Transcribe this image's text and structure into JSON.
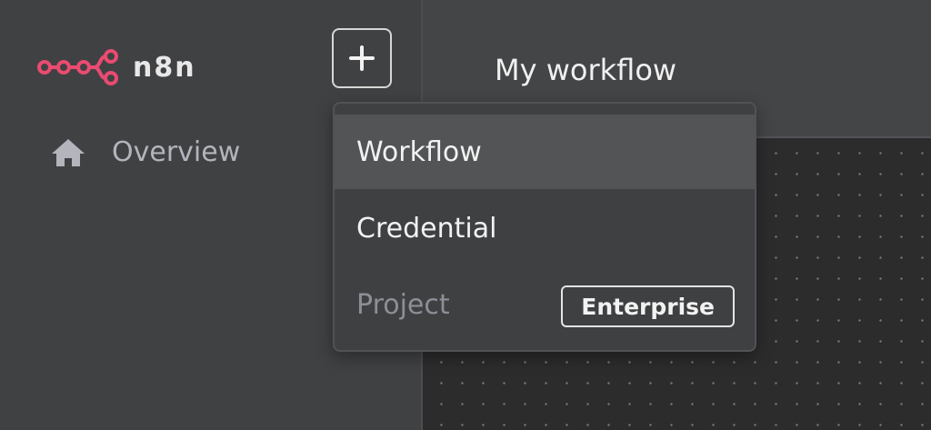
{
  "app": {
    "name": "n8n",
    "brand_color": "#EA4B71",
    "logo_icon": "n8n-logo-icon"
  },
  "sidebar": {
    "add_button_icon": "plus-icon",
    "items": [
      {
        "label": "Overview",
        "icon": "home-icon"
      }
    ]
  },
  "header": {
    "workflow_title": "My workflow"
  },
  "add_menu": {
    "items": [
      {
        "label": "Workflow",
        "state": "hover"
      },
      {
        "label": "Credential"
      },
      {
        "label": "Project",
        "disabled": true,
        "badge": "Enterprise"
      }
    ]
  }
}
